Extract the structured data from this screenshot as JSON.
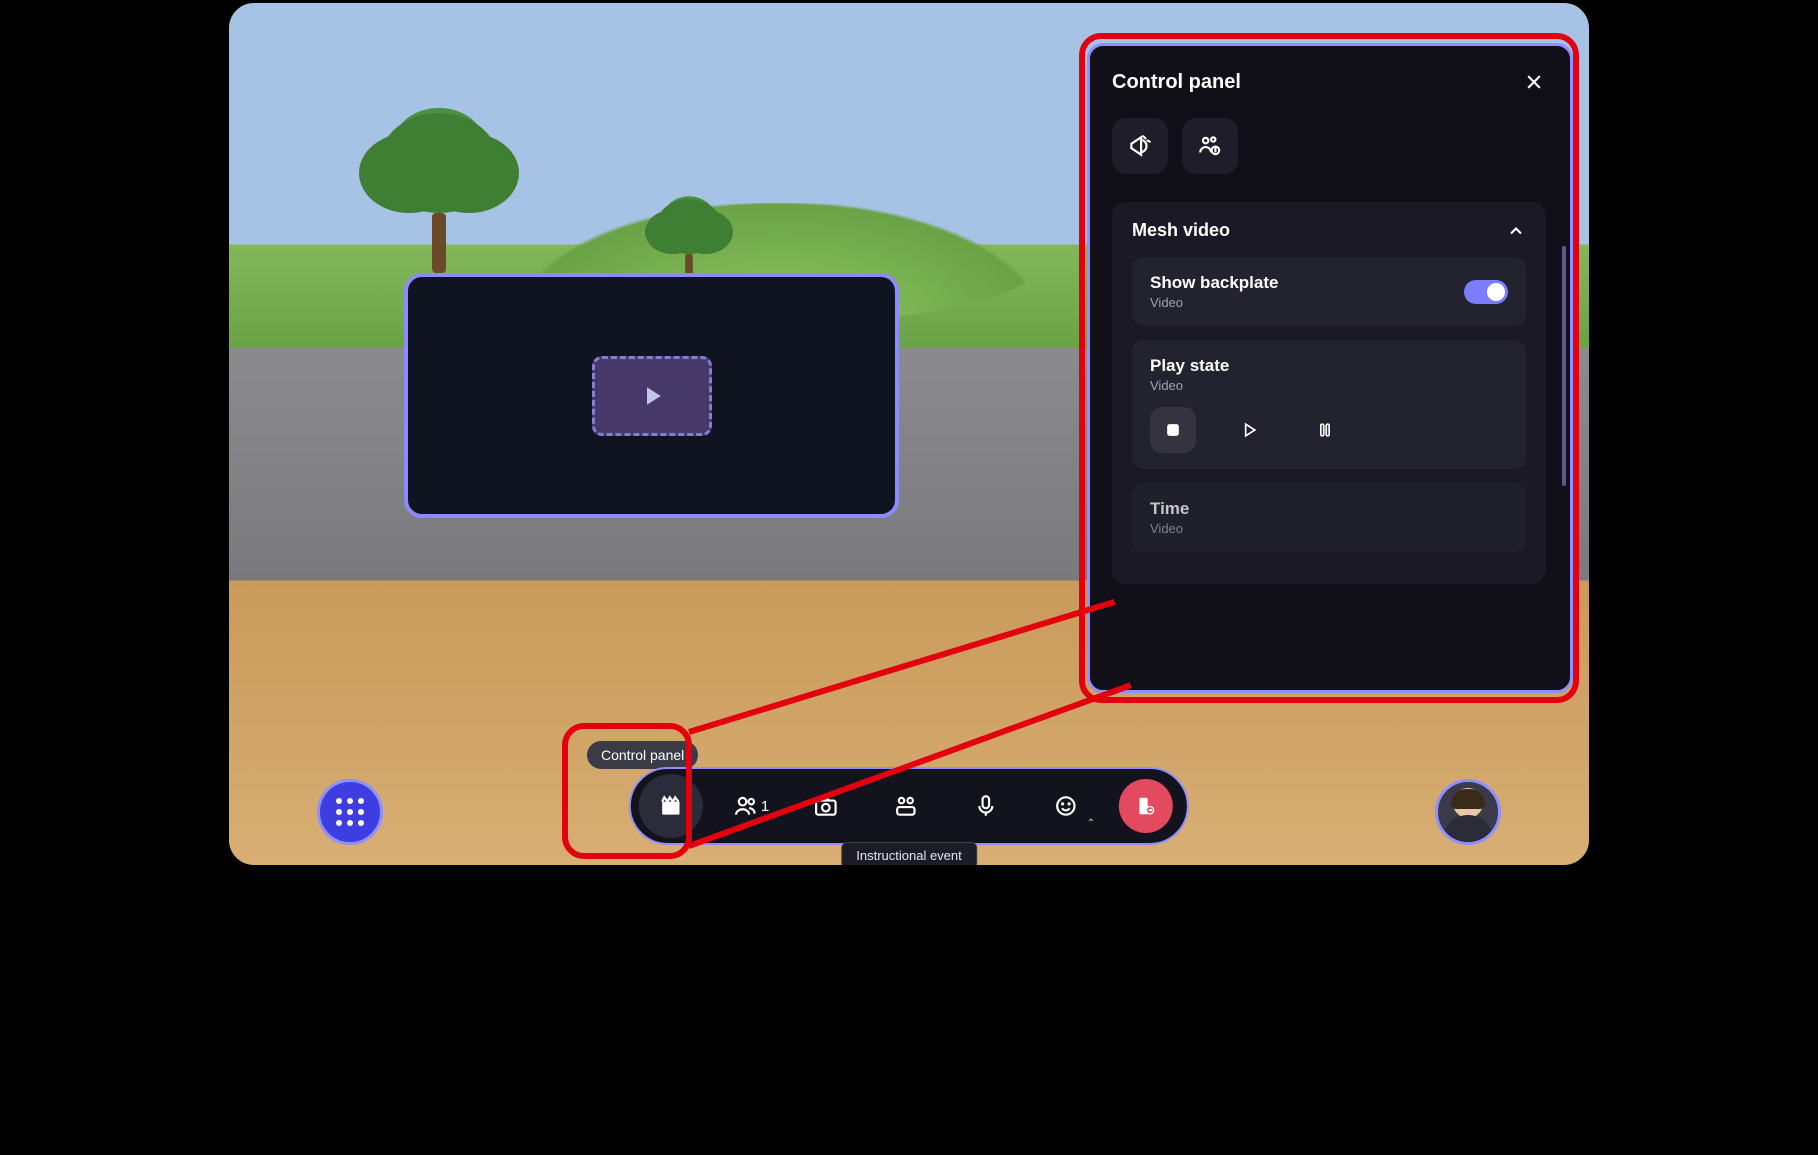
{
  "tooltip": "Control panel",
  "caption": "Instructional event",
  "people_count": "1",
  "panel": {
    "title": "Control panel",
    "section_title": "Mesh video",
    "backplate": {
      "title": "Show backplate",
      "sub": "Video",
      "on": true
    },
    "playstate": {
      "title": "Play state",
      "sub": "Video"
    },
    "time": {
      "title": "Time",
      "sub": "Video"
    }
  }
}
